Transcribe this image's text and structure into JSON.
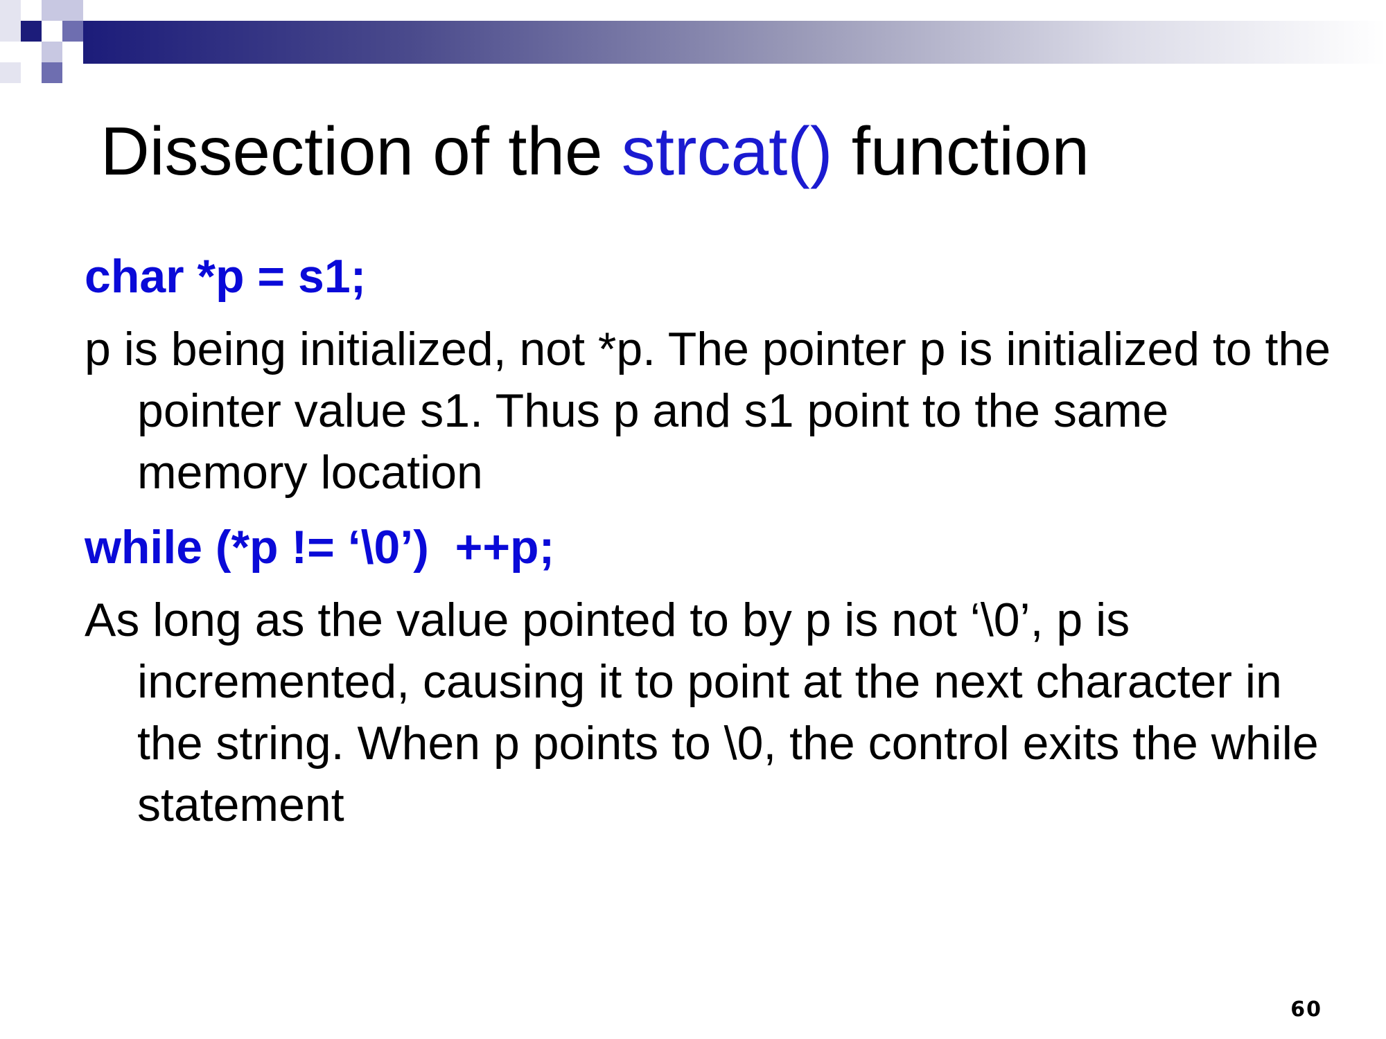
{
  "slide": {
    "title_prefix": "Dissection of the ",
    "title_accent": "strcat()",
    "title_suffix": " function",
    "code_1": "char *p = s1;",
    "para_1": "p is being initialized, not *p. The pointer p is initialized to the pointer value s1. Thus p and s1 point to the same memory location",
    "code_2": "while (*p != ‘\\0’)  ++p;",
    "para_2": "As long as the value pointed to by p is not ‘\\0’, p is incremented, causing it to point at the next character in the string. When p points to \\0, the control exits the while statement",
    "page_number": "60"
  },
  "colors": {
    "title_accent": "#1a1ad0",
    "code": "#0a0ad8",
    "header_dark": "#1c1c7a"
  }
}
